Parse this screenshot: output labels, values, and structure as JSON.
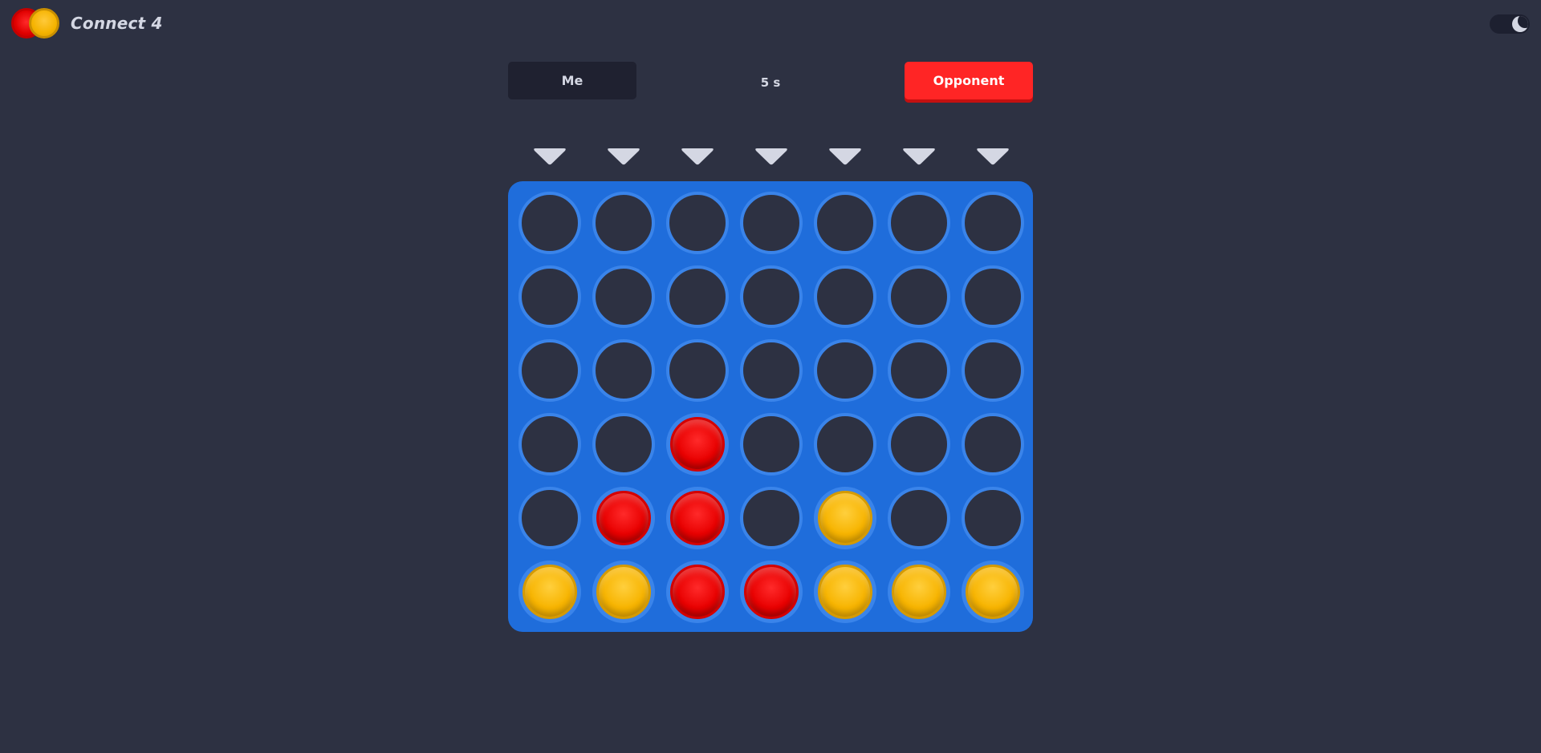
{
  "app": {
    "title": "Connect 4"
  },
  "theme": {
    "mode": "dark",
    "icon": "moon-icon"
  },
  "players": {
    "me_label": "Me",
    "opponent_label": "Opponent",
    "active": "opponent"
  },
  "timer": {
    "text": "5 s"
  },
  "colors": {
    "background": "#2d3142",
    "board": "#1f6ddb",
    "red_disc": "#e80000",
    "yellow_disc": "#f7b400",
    "opponent_button": "#ff2525"
  },
  "board": {
    "columns": 7,
    "rows": 6,
    "grid": [
      [
        "empty",
        "empty",
        "empty",
        "empty",
        "empty",
        "empty",
        "empty"
      ],
      [
        "empty",
        "empty",
        "empty",
        "empty",
        "empty",
        "empty",
        "empty"
      ],
      [
        "empty",
        "empty",
        "empty",
        "empty",
        "empty",
        "empty",
        "empty"
      ],
      [
        "empty",
        "empty",
        "red",
        "empty",
        "empty",
        "empty",
        "empty"
      ],
      [
        "empty",
        "red",
        "red",
        "empty",
        "yellow",
        "empty",
        "empty"
      ],
      [
        "yellow",
        "yellow",
        "red",
        "red",
        "yellow",
        "yellow",
        "yellow"
      ]
    ]
  }
}
